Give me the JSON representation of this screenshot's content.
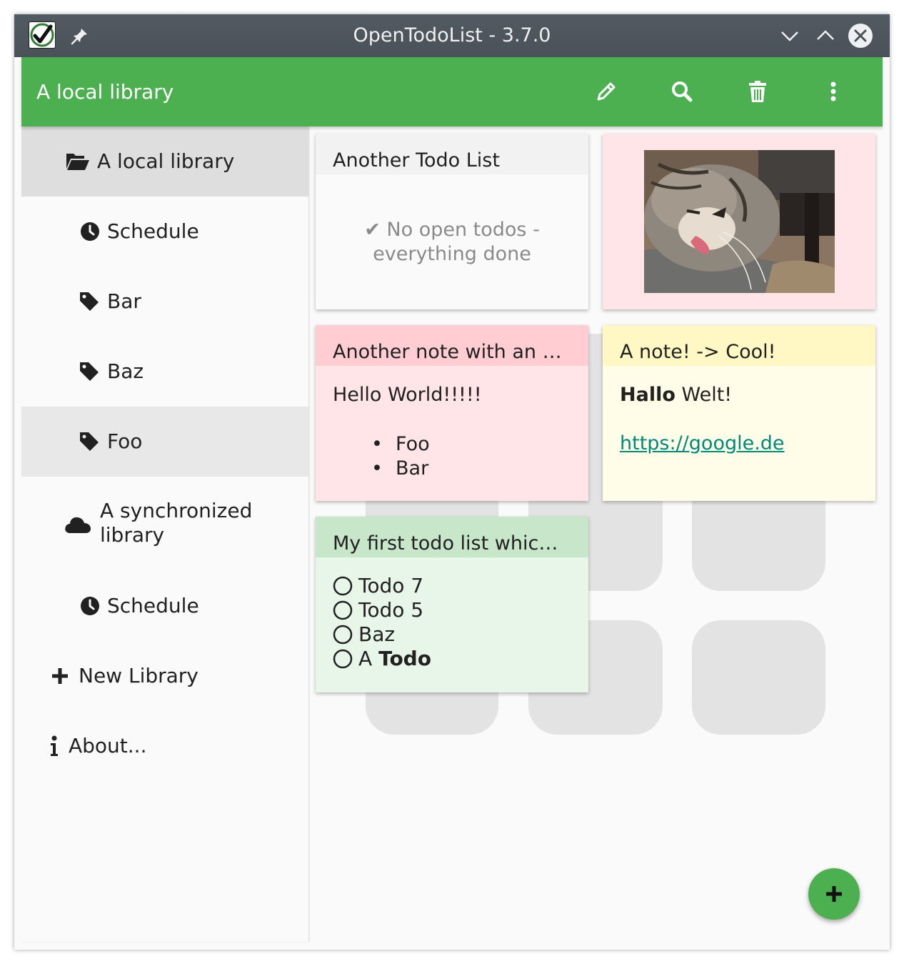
{
  "window": {
    "title": "OpenTodoList - 3.7.0"
  },
  "appbar": {
    "title": "A local library",
    "icons": [
      "edit-icon",
      "search-icon",
      "trash-icon",
      "more-vertical-icon"
    ]
  },
  "sidebar": {
    "items": [
      {
        "label": "A local library",
        "icon": "folder-open-icon",
        "selected": true
      },
      {
        "label": "Schedule",
        "icon": "clock-icon"
      },
      {
        "label": "Bar",
        "icon": "tag-icon"
      },
      {
        "label": "Baz",
        "icon": "tag-icon"
      },
      {
        "label": "Foo",
        "icon": "tag-icon",
        "highlighted": true
      },
      {
        "label_line1": "A synchronized",
        "label_line2": "library",
        "icon": "cloud-icon"
      },
      {
        "label": "Schedule",
        "icon": "clock-icon"
      },
      {
        "label": "New Library",
        "icon": "plus-icon"
      },
      {
        "label": "About...",
        "icon": "info-icon"
      }
    ]
  },
  "cards": {
    "another_todo_list": {
      "title": "Another Todo List",
      "empty_line1": "✔ No open todos -",
      "empty_line2": "everything done",
      "color": "#fafafa"
    },
    "image_card": {
      "color": "#ffe4e8",
      "image": "sleeping-cat-photo"
    },
    "note_pink": {
      "title": "Another note with an …",
      "text": "Hello World!!!!!",
      "bullets": [
        "Foo",
        "Bar"
      ],
      "header_color": "#ffcdd2",
      "body_color": "#ffe4e8"
    },
    "note_yellow": {
      "title": "A note! -> Cool!",
      "bold": "Hallo",
      "text": " Welt!",
      "link": "https://google.de",
      "header_color": "#fff8c4",
      "body_color": "#fffde7"
    },
    "todo_list_green": {
      "title": "My first todo list whic…",
      "todos": [
        {
          "label": "Todo 7"
        },
        {
          "label": "Todo 5"
        },
        {
          "label": "Baz"
        },
        {
          "prefix": "A ",
          "bold": "Todo"
        }
      ],
      "header_color": "#c8e6c9",
      "body_color": "#e8f5e9"
    }
  },
  "fab": {
    "icon": "plus-icon",
    "color": "#4caf50"
  },
  "colors": {
    "accent": "#4caf50",
    "link": "#00897b"
  }
}
